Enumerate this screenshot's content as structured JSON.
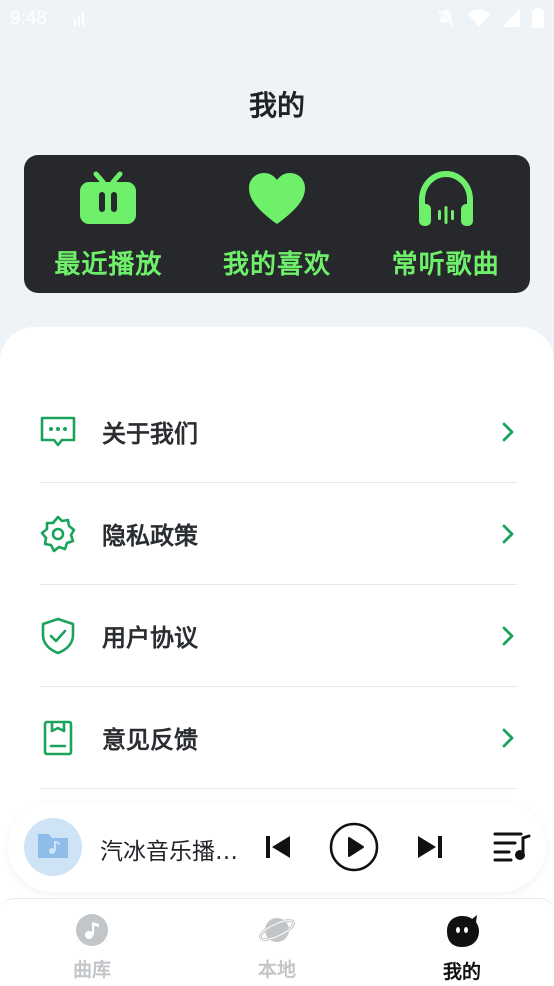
{
  "status_bar": {
    "time": "9:48"
  },
  "page": {
    "title": "我的"
  },
  "quick": {
    "accent": "#6ff06a",
    "items": [
      {
        "label": "最近播放",
        "icon": "tv-icon"
      },
      {
        "label": "我的喜欢",
        "icon": "heart-icon"
      },
      {
        "label": "常听歌曲",
        "icon": "headphones-icon"
      }
    ]
  },
  "menu": {
    "accent": "#1aa35b",
    "items": [
      {
        "label": "关于我们",
        "icon": "chat-bubble-icon"
      },
      {
        "label": "隐私政策",
        "icon": "gear-icon"
      },
      {
        "label": "用户协议",
        "icon": "shield-check-icon"
      },
      {
        "label": "意见反馈",
        "icon": "clipboard-icon"
      }
    ]
  },
  "player": {
    "song_title": "汽冰音乐播放器"
  },
  "tabs": {
    "items": [
      {
        "label": "曲库",
        "icon": "music-note-icon"
      },
      {
        "label": "本地",
        "icon": "planet-icon"
      },
      {
        "label": "我的",
        "icon": "mascot-icon"
      }
    ],
    "active": "我的"
  }
}
